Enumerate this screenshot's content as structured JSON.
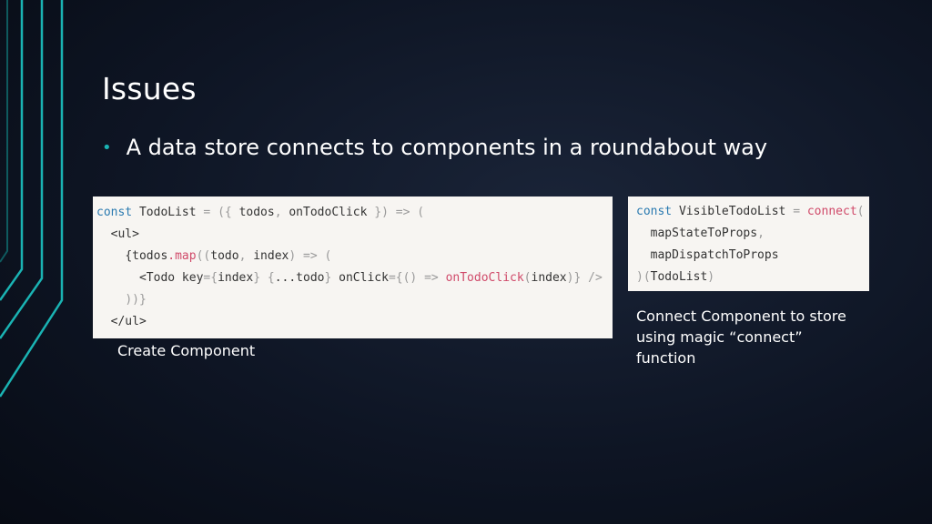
{
  "slide": {
    "title": "Issues",
    "bullet": "A data store connects to components in a roundabout way",
    "caption_left": "Create Component",
    "caption_right": "Connect Component to store using magic “connect” function"
  },
  "code_left": {
    "l1": [
      "const",
      " TodoList ",
      "=",
      " ({ ",
      "todos",
      ", ",
      "onTodoClick",
      " }) ",
      "=>",
      " ("
    ],
    "l2": [
      "<ul>"
    ],
    "l3": [
      "{todos",
      ".map",
      "((",
      "todo",
      ", ",
      "index",
      ") ",
      "=>",
      " ("
    ],
    "l4": [
      "<Todo key",
      "={",
      "index",
      "} {",
      "...todo",
      "} ",
      "onClick",
      "={() ",
      "=>",
      " onTodoClick",
      "(",
      "index",
      ")} />"
    ],
    "l5": [
      "))}"
    ],
    "l6": [
      "</ul>"
    ]
  },
  "code_right": {
    "l1": [
      "const",
      " VisibleTodoList ",
      "=",
      " connect",
      "("
    ],
    "l2": [
      "mapStateToProps",
      ","
    ],
    "l3": [
      "mapDispatchToProps"
    ],
    "l4": [
      ")(",
      "TodoList",
      ")"
    ]
  },
  "colors": {
    "accent_lines": "#1ab3b3",
    "keyword": "#2a7ab0",
    "function": "#d04a6a",
    "code_background": "#f7f5f2"
  }
}
